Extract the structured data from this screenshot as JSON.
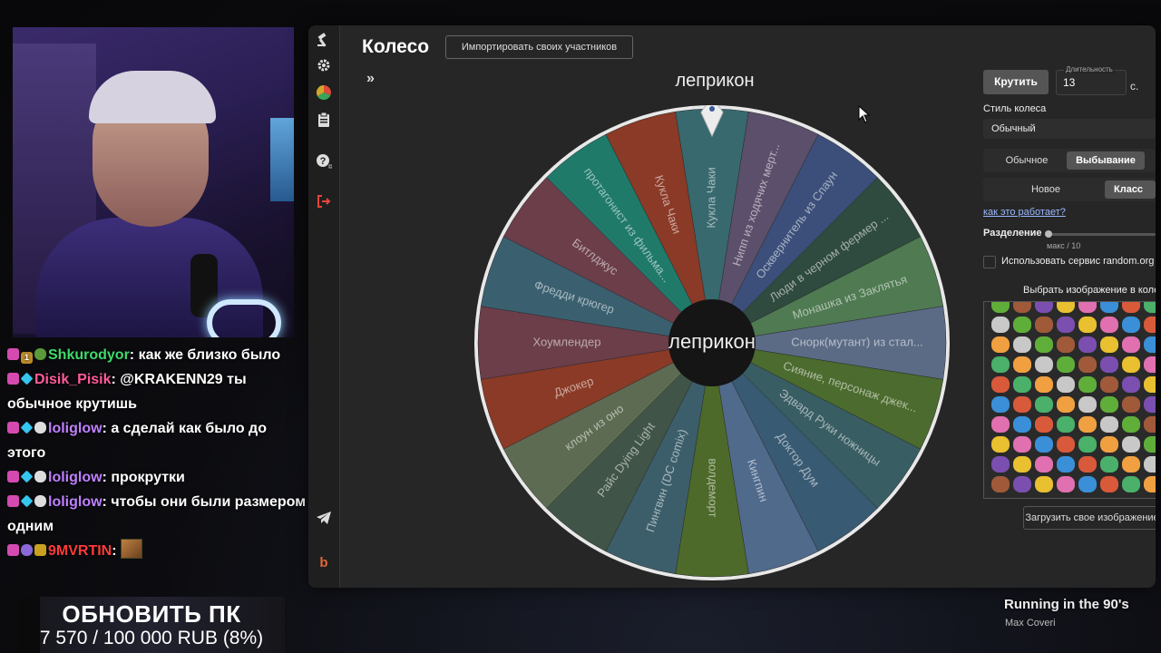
{
  "chat": [
    {
      "badges": [
        "heart",
        "num",
        "frog"
      ],
      "badge_text": "1",
      "user": "Shkurodyor",
      "user_class": "u1",
      "text": "как же близко было"
    },
    {
      "badges": [
        "heart",
        "gem"
      ],
      "user": "Disik_Pisik",
      "user_class": "u2",
      "text": "@KRAKENN29 ты обычное крутишь"
    },
    {
      "badges": [
        "heart",
        "gem",
        "white"
      ],
      "user": "loliglow",
      "user_class": "u3",
      "text": "а сделай как было до этого"
    },
    {
      "badges": [
        "heart",
        "gem",
        "white"
      ],
      "user": "loliglow",
      "user_class": "u3",
      "text": "прокрутки"
    },
    {
      "badges": [
        "heart",
        "gem",
        "white"
      ],
      "user": "loliglow",
      "user_class": "u3",
      "text": "чтобы они были размером одним"
    },
    {
      "badges": [
        "heart",
        "skull",
        "gift"
      ],
      "user": "9MVRTIN",
      "user_class": "u4",
      "text": "",
      "emote": true
    }
  ],
  "donation": {
    "title": "ОБНОВИТЬ ПК",
    "progress_text": "7 570 / 100 000 RUB (8%)",
    "progress": 0.08
  },
  "app": {
    "title": "Колесо",
    "import_label": "Импортировать своих участников",
    "expand_glyph": "»",
    "winner_top": "леприкон",
    "winner_center": "леприкон",
    "nav_icons": [
      "gavel-icon",
      "gear-icon",
      "pie-chart-icon",
      "clipboard-icon",
      "help-icon",
      "logout-icon",
      "telegram-icon",
      "bitcoin-icon"
    ]
  },
  "wheel": {
    "colors": [
      "#38696f",
      "#5b4f6b",
      "#3b4f7a",
      "#2f4a3e",
      "#4f7a52",
      "#5b6b85",
      "#4c6b2e",
      "#385d62",
      "#385a72",
      "#506a8c",
      "#4d6a2a",
      "#3c5e6a",
      "#405448",
      "#5d6b52",
      "#8a3a26",
      "#6b3e4a",
      "#3a6070",
      "#6b3e4a",
      "#1f7a6a",
      "#8a3a26"
    ],
    "segments": [
      "Кукла Чаки",
      "Нипп из ходячих мерт...",
      "Осквернитель из Спаун",
      "Люди в черном фермер ...",
      "Монашка из Заклятья",
      "Снорк(мутант) из стал...",
      "Сияние, персонаж джек...",
      "Эдвард Руки ножницы",
      "Доктор Дум",
      "Кингпин",
      "волдеморт",
      "Пингвин (DC comix)",
      "Райс Dying Light",
      "клоун из оно",
      "Джокер",
      "Хоумлендер",
      "Фредди крюгер",
      "Битлджус",
      "протагонист из фильма...",
      "Кукла Чаки"
    ]
  },
  "panel": {
    "spin_label": "Крутить",
    "duration_label": "Длительность",
    "duration_value": "13",
    "duration_unit": "с.",
    "style_label": "Стиль колеса",
    "style_value": "Обычный",
    "mode_options": [
      "Обычное",
      "Выбывание"
    ],
    "mode_active": "Выбывание",
    "variant_options": [
      "Новое",
      "Класс"
    ],
    "variant_active": "Класс",
    "how_link": "как это работает?",
    "division_label": "Разделение",
    "division_sub": "макс / 10",
    "random_org_label": "Использовать сервис random.org",
    "image_label": "Выбрать изображение в колесо",
    "upload_label": "Загрузить свое изображение"
  },
  "now_playing": {
    "title": "Running in the 90's",
    "artist": "Max Coveri"
  }
}
